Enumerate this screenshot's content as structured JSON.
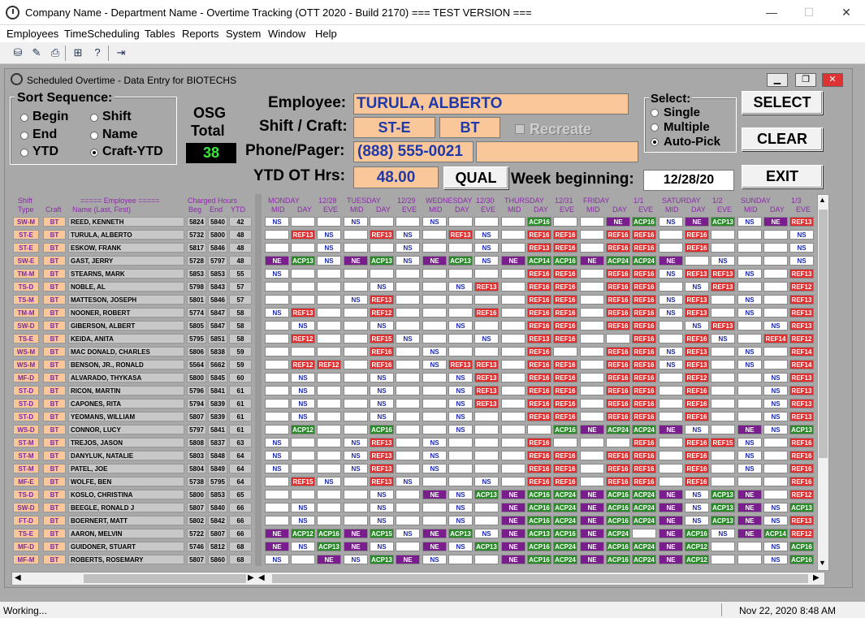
{
  "window": {
    "title": "Company Name - Department Name - Overtime Tracking (OTT 2020 - Build 2170) === TEST VERSION ===",
    "minimize": "—",
    "maximize": "☐",
    "close": "✕"
  },
  "menu": [
    "Employees",
    "TimeScheduling",
    "Tables",
    "Reports",
    "System",
    "Window",
    "Help"
  ],
  "inner": {
    "title": "Scheduled Overtime - Data Entry for BIOTECHS"
  },
  "sort": {
    "label": "Sort Sequence:",
    "options": [
      "Begin",
      "End",
      "YTD",
      "Shift",
      "Name",
      "Craft-YTD"
    ],
    "selected": "Craft-YTD"
  },
  "osg": {
    "label1": "OSG",
    "label2": "Total",
    "value": "38"
  },
  "employee": {
    "label": "Employee:",
    "value": "TURULA, ALBERTO"
  },
  "shiftcraft": {
    "label": "Shift / Craft:",
    "shift": "ST-E",
    "craft": "BT"
  },
  "recreate": "Recreate",
  "phone": {
    "label": "Phone/Pager:",
    "value": "(888) 555-0021",
    "pager": ""
  },
  "ytd": {
    "label": "YTD OT Hrs:",
    "value": "48.00"
  },
  "qual": "QUAL",
  "week": {
    "label": "Week beginning:",
    "value": "12/28/20"
  },
  "select": {
    "label": "Select:",
    "options": [
      "Single",
      "Multiple",
      "Auto-Pick"
    ],
    "selected": "Auto-Pick"
  },
  "buttons": {
    "select": "SELECT",
    "clear": "CLEAR",
    "exit": "EXIT"
  },
  "grid_headers": {
    "shift": "Shift",
    "type": "Type",
    "craft": "Craft",
    "employee": "===== Employee =====",
    "name": "Name (Last, First)",
    "charged": "Charged Hours",
    "beg": "Beg",
    "end": "End",
    "ytd": "YTD"
  },
  "days": [
    {
      "day": "MONDAY",
      "date": "12/28"
    },
    {
      "day": "TUESDAY",
      "date": "12/29"
    },
    {
      "day": "WEDNESDAY",
      "date": "12/30"
    },
    {
      "day": "THURSDAY",
      "date": "12/31"
    },
    {
      "day": "FRIDAY",
      "date": "1/1"
    },
    {
      "day": "SATURDAY",
      "date": "1/2"
    },
    {
      "day": "SUNDAY",
      "date": "1/3"
    }
  ],
  "shifts": [
    "MID",
    "DAY",
    "EVE"
  ],
  "rows": [
    {
      "st": "SW-M",
      "cr": "BT",
      "nm": "REED, KENNETH",
      "b": "5824",
      "e": "5840",
      "y": "42",
      "c": [
        "NS",
        "",
        "",
        "NS",
        "",
        "",
        "NS",
        "",
        "",
        "",
        "ACP16",
        "",
        "",
        "NE",
        "ACP16",
        "NS",
        "NE",
        "ACP13",
        "NS",
        "NE",
        "REF13"
      ]
    },
    {
      "st": "ST-E",
      "cr": "BT",
      "nm": "TURULA, ALBERTO",
      "b": "5732",
      "e": "5800",
      "y": "48",
      "c": [
        "",
        "REF13",
        "NS",
        "",
        "REF13",
        "NS",
        "",
        "REF13",
        "NS",
        "",
        "REF16",
        "REF16",
        "",
        "REF16",
        "REF16",
        "",
        "REF16",
        "",
        "",
        "",
        "NS"
      ]
    },
    {
      "st": "ST-E",
      "cr": "BT",
      "nm": "ESKOW, FRANK",
      "b": "5817",
      "e": "5846",
      "y": "48",
      "c": [
        "",
        "",
        "NS",
        "",
        "",
        "NS",
        "",
        "",
        "NS",
        "",
        "REF13",
        "REF16",
        "",
        "REF16",
        "REF16",
        "",
        "REF16",
        "",
        "",
        "",
        "NS"
      ]
    },
    {
      "st": "SW-E",
      "cr": "BT",
      "nm": "GAST, JERRY",
      "b": "5728",
      "e": "5797",
      "y": "48",
      "c": [
        "NE",
        "ACP13",
        "NS",
        "NE",
        "ACP13",
        "NS",
        "NE",
        "ACP13",
        "NS",
        "NE",
        "ACP14",
        "ACP16",
        "NE",
        "ACP24",
        "ACP24",
        "NE",
        "",
        "NS",
        "",
        "",
        "NS"
      ]
    },
    {
      "st": "TM-M",
      "cr": "BT",
      "nm": "STEARNS, MARK",
      "b": "5853",
      "e": "5853",
      "y": "55",
      "c": [
        "NS",
        "",
        "",
        "",
        "",
        "",
        "",
        "",
        "",
        "",
        "REF16",
        "REF16",
        "",
        "REF16",
        "REF16",
        "NS",
        "REF13",
        "REF13",
        "NS",
        "",
        "REF13"
      ]
    },
    {
      "st": "TS-D",
      "cr": "BT",
      "nm": "NOBLE, AL",
      "b": "5798",
      "e": "5843",
      "y": "57",
      "c": [
        "",
        "",
        "",
        "",
        "NS",
        "",
        "",
        "NS",
        "REF13",
        "",
        "REF16",
        "REF16",
        "",
        "REF16",
        "REF16",
        "",
        "NS",
        "REF13",
        "",
        "",
        "REF12"
      ]
    },
    {
      "st": "TS-M",
      "cr": "BT",
      "nm": "MATTESON, JOSEPH",
      "b": "5801",
      "e": "5846",
      "y": "57",
      "c": [
        "",
        "",
        "",
        "NS",
        "REF13",
        "",
        "",
        "",
        "",
        "",
        "REF16",
        "REF16",
        "",
        "REF16",
        "REF16",
        "NS",
        "REF13",
        "",
        "NS",
        "",
        "REF13"
      ]
    },
    {
      "st": "TM-M",
      "cr": "BT",
      "nm": "NOONER, ROBERT",
      "b": "5774",
      "e": "5847",
      "y": "58",
      "c": [
        "NS",
        "REF13",
        "",
        "",
        "REF12",
        "",
        "",
        "",
        "REF16",
        "",
        "REF16",
        "REF16",
        "",
        "REF16",
        "REF16",
        "NS",
        "REF13",
        "",
        "NS",
        "",
        "REF13"
      ]
    },
    {
      "st": "SW-D",
      "cr": "BT",
      "nm": "GIBERSON, ALBERT",
      "b": "5805",
      "e": "5847",
      "y": "58",
      "c": [
        "",
        "NS",
        "",
        "",
        "NS",
        "",
        "",
        "NS",
        "",
        "",
        "REF16",
        "REF16",
        "",
        "REF16",
        "REF16",
        "",
        "NS",
        "REF13",
        "",
        "NS",
        "REF13"
      ]
    },
    {
      "st": "TS-E",
      "cr": "BT",
      "nm": "KEIDA, ANITA",
      "b": "5795",
      "e": "5851",
      "y": "58",
      "c": [
        "",
        "REF12",
        "",
        "",
        "REF15",
        "NS",
        "",
        "",
        "NS",
        "",
        "REF13",
        "REF16",
        "",
        "",
        "REF16",
        "",
        "REF16",
        "NS",
        "",
        "REF14",
        "REF12"
      ]
    },
    {
      "st": "WS-M",
      "cr": "BT",
      "nm": "MAC DONALD, CHARLES",
      "b": "5806",
      "e": "5838",
      "y": "59",
      "c": [
        "",
        "",
        "",
        "",
        "REF16",
        "",
        "NS",
        "",
        "",
        "",
        "REF16",
        "",
        "",
        "REF16",
        "REF16",
        "NS",
        "REF13",
        "",
        "NS",
        "",
        "REF14"
      ]
    },
    {
      "st": "WS-M",
      "cr": "BT",
      "nm": "BENSON, JR., RONALD",
      "b": "5564",
      "e": "5662",
      "y": "59",
      "c": [
        "",
        "REF12",
        "REF12",
        "",
        "REF16",
        "",
        "NS",
        "REF13",
        "REF13",
        "",
        "REF16",
        "REF16",
        "",
        "REF16",
        "REF16",
        "NS",
        "REF13",
        "",
        "NS",
        "",
        "REF14"
      ]
    },
    {
      "st": "MF-D",
      "cr": "BT",
      "nm": "ALVARADO, THYKASA",
      "b": "5800",
      "e": "5845",
      "y": "60",
      "c": [
        "",
        "NS",
        "",
        "",
        "NS",
        "",
        "",
        "NS",
        "REF13",
        "",
        "REF16",
        "REF16",
        "",
        "REF16",
        "REF16",
        "",
        "REF12",
        "",
        "",
        "NS",
        "REF13"
      ]
    },
    {
      "st": "ST-D",
      "cr": "BT",
      "nm": "RICON, MARTIN",
      "b": "5796",
      "e": "5841",
      "y": "61",
      "c": [
        "",
        "NS",
        "",
        "",
        "NS",
        "",
        "",
        "NS",
        "REF13",
        "",
        "REF16",
        "REF16",
        "",
        "REF16",
        "REF16",
        "",
        "REF16",
        "",
        "",
        "NS",
        "REF13"
      ]
    },
    {
      "st": "ST-D",
      "cr": "BT",
      "nm": "CAPONES, RITA",
      "b": "5794",
      "e": "5839",
      "y": "61",
      "c": [
        "",
        "NS",
        "",
        "",
        "NS",
        "",
        "",
        "NS",
        "REF13",
        "",
        "REF16",
        "REF16",
        "",
        "REF16",
        "REF16",
        "",
        "REF16",
        "",
        "",
        "NS",
        "REF13"
      ]
    },
    {
      "st": "ST-D",
      "cr": "BT",
      "nm": "YEOMANS, WILLIAM",
      "b": "5807",
      "e": "5839",
      "y": "61",
      "c": [
        "",
        "NS",
        "",
        "",
        "NS",
        "",
        "",
        "NS",
        "",
        "",
        "REF16",
        "REF16",
        "",
        "REF16",
        "REF16",
        "",
        "REF16",
        "",
        "",
        "NS",
        "REF13"
      ]
    },
    {
      "st": "WS-D",
      "cr": "BT",
      "nm": "CONNOR, LUCY",
      "b": "5797",
      "e": "5841",
      "y": "61",
      "c": [
        "",
        "ACP12",
        "",
        "",
        "ACP16",
        "",
        "",
        "NS",
        "",
        "",
        "",
        "ACP16",
        "NE",
        "ACP24",
        "ACP24",
        "NE",
        "NS",
        "",
        "NE",
        "NS",
        "ACP13"
      ]
    },
    {
      "st": "ST-M",
      "cr": "BT",
      "nm": "TREJOS, JASON",
      "b": "5808",
      "e": "5837",
      "y": "63",
      "c": [
        "NS",
        "",
        "",
        "NS",
        "REF13",
        "",
        "NS",
        "",
        "",
        "",
        "REF16",
        "",
        "",
        "",
        "REF16",
        "",
        "REF16",
        "REF15",
        "NS",
        "",
        "REF16"
      ]
    },
    {
      "st": "ST-M",
      "cr": "BT",
      "nm": "DANYLUK, NATALIE",
      "b": "5803",
      "e": "5848",
      "y": "64",
      "c": [
        "NS",
        "",
        "",
        "NS",
        "REF13",
        "",
        "NS",
        "",
        "",
        "",
        "REF16",
        "REF16",
        "",
        "REF16",
        "REF16",
        "",
        "REF16",
        "",
        "NS",
        "",
        "REF16"
      ]
    },
    {
      "st": "ST-M",
      "cr": "BT",
      "nm": "PATEL, JOE",
      "b": "5804",
      "e": "5849",
      "y": "64",
      "c": [
        "NS",
        "",
        "",
        "NS",
        "REF13",
        "",
        "NS",
        "",
        "",
        "",
        "REF16",
        "REF16",
        "",
        "REF16",
        "REF16",
        "",
        "REF16",
        "",
        "NS",
        "",
        "REF16"
      ]
    },
    {
      "st": "MF-E",
      "cr": "BT",
      "nm": "WOLFE, BEN",
      "b": "5738",
      "e": "5795",
      "y": "64",
      "c": [
        "",
        "REF15",
        "NS",
        "",
        "REF13",
        "NS",
        "",
        "",
        "NS",
        "",
        "REF16",
        "REF16",
        "",
        "REF16",
        "REF16",
        "",
        "REF16",
        "",
        "",
        "",
        "REF16"
      ]
    },
    {
      "st": "TS-D",
      "cr": "BT",
      "nm": "KOSLO, CHRISTINA",
      "b": "5800",
      "e": "5853",
      "y": "65",
      "c": [
        "",
        "",
        "",
        "",
        "NS",
        "",
        "NE",
        "NS",
        "ACP13",
        "NE",
        "ACP16",
        "ACP24",
        "NE",
        "ACP16",
        "ACP24",
        "NE",
        "NS",
        "ACP13",
        "NE",
        "",
        "REF12"
      ]
    },
    {
      "st": "SW-D",
      "cr": "BT",
      "nm": "BEEGLE, RONALD J",
      "b": "5807",
      "e": "5840",
      "y": "66",
      "c": [
        "",
        "NS",
        "",
        "",
        "NS",
        "",
        "",
        "NS",
        "",
        "NE",
        "ACP16",
        "ACP24",
        "NE",
        "ACP16",
        "ACP24",
        "NE",
        "NS",
        "ACP13",
        "NE",
        "NS",
        "ACP13"
      ]
    },
    {
      "st": "FT-D",
      "cr": "BT",
      "nm": "BOERNERT, MATT",
      "b": "5802",
      "e": "5842",
      "y": "66",
      "c": [
        "",
        "NS",
        "",
        "",
        "NS",
        "",
        "",
        "NS",
        "",
        "NE",
        "ACP16",
        "ACP24",
        "NE",
        "ACP16",
        "ACP24",
        "NE",
        "NS",
        "ACP13",
        "NE",
        "NS",
        "REF13"
      ]
    },
    {
      "st": "TS-E",
      "cr": "BT",
      "nm": "AARON, MELVIN",
      "b": "5722",
      "e": "5807",
      "y": "66",
      "c": [
        "NE",
        "ACP12",
        "ACP16",
        "NE",
        "ACP15",
        "NS",
        "NE",
        "ACP13",
        "NS",
        "NE",
        "ACP13",
        "ACP16",
        "NE",
        "ACP24",
        "",
        "NE",
        "ACP16",
        "NS",
        "NE",
        "ACP14",
        "REF12"
      ]
    },
    {
      "st": "MF-D",
      "cr": "BT",
      "nm": "GUIDONER, STUART",
      "b": "5746",
      "e": "5812",
      "y": "68",
      "c": [
        "NE",
        "NS",
        "ACP13",
        "NE",
        "NS",
        "",
        "NE",
        "NS",
        "ACP13",
        "NE",
        "ACP16",
        "ACP24",
        "NE",
        "ACP16",
        "ACP24",
        "NE",
        "ACP12",
        "",
        "",
        "NS",
        "ACP16"
      ]
    },
    {
      "st": "MF-M",
      "cr": "BT",
      "nm": "ROBERTS, ROSEMARY",
      "b": "5807",
      "e": "5860",
      "y": "68",
      "c": [
        "NS",
        "",
        "NE",
        "NS",
        "ACP13",
        "NE",
        "NS",
        "",
        "",
        "NE",
        "ACP16",
        "ACP24",
        "NE",
        "ACP16",
        "ACP24",
        "NE",
        "ACP12",
        "",
        "",
        "NS",
        "ACP16"
      ]
    }
  ],
  "status": {
    "left": "Working...",
    "date": "Nov 22, 2020",
    "time": "8:48 AM"
  }
}
